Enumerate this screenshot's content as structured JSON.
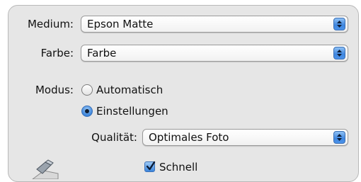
{
  "medium": {
    "label": "Medium:",
    "value": "Epson Matte"
  },
  "farbe": {
    "label": "Farbe:",
    "value": "Farbe"
  },
  "modus": {
    "label": "Modus:",
    "options": [
      {
        "label": "Automatisch",
        "selected": false
      },
      {
        "label": "Einstellungen",
        "selected": true
      }
    ]
  },
  "qualitaet": {
    "label": "Qualität:",
    "value": "Optimales Foto"
  },
  "schnell": {
    "label": "Schnell",
    "checked": true
  },
  "icons": {
    "ink": "ink-cartridge-icon"
  },
  "colors": {
    "accent": "#3f86df",
    "panel": "#e6e6e6"
  }
}
